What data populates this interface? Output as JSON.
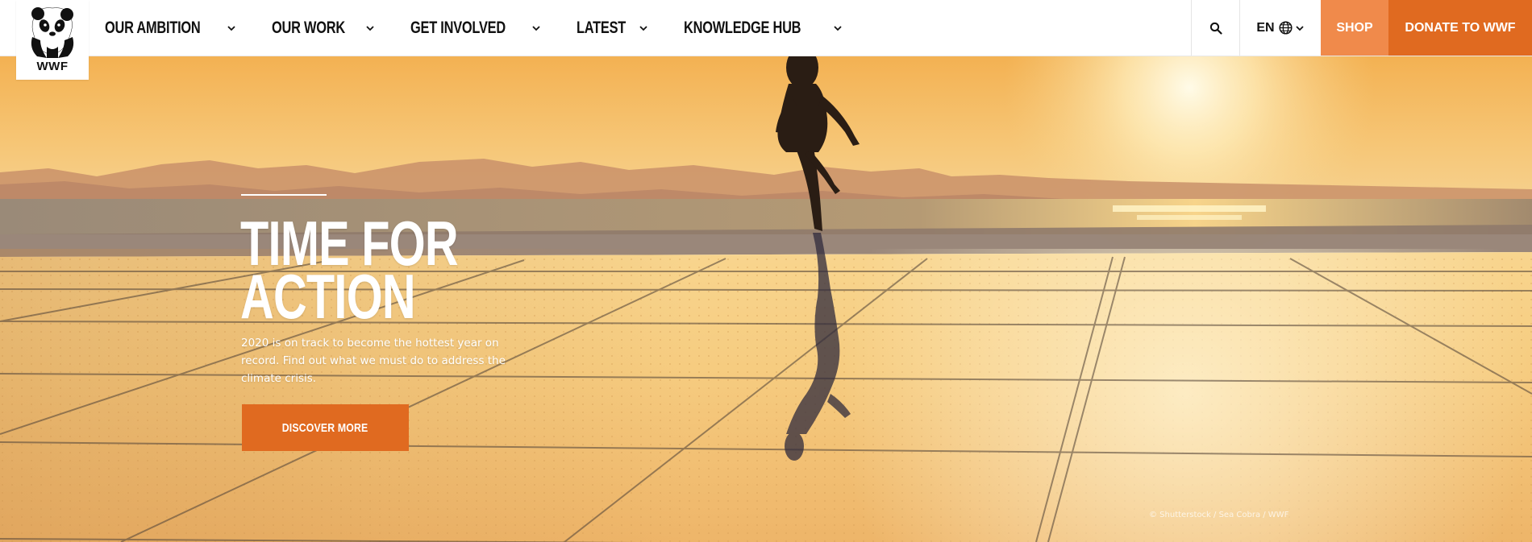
{
  "logo": {
    "text": "WWF"
  },
  "nav": {
    "items": [
      {
        "label": "OUR AMBITION"
      },
      {
        "label": "OUR WORK"
      },
      {
        "label": "GET INVOLVED"
      },
      {
        "label": "LATEST"
      },
      {
        "label": "KNOWLEDGE HUB"
      }
    ]
  },
  "utility": {
    "language": "EN",
    "shop_label": "SHOP",
    "donate_label": "DONATE TO WWF"
  },
  "hero": {
    "title_line1": "TIME FOR",
    "title_line2": "ACTION",
    "body": "2020 is on track to become the hottest year on record. Find out what we must do to address the climate crisis.",
    "cta_label": "DISCOVER MORE",
    "credit": "© Shutterstock / Sea Cobra / WWF"
  },
  "colors": {
    "accent": "#e06a20",
    "shop": "#f08a4b"
  }
}
